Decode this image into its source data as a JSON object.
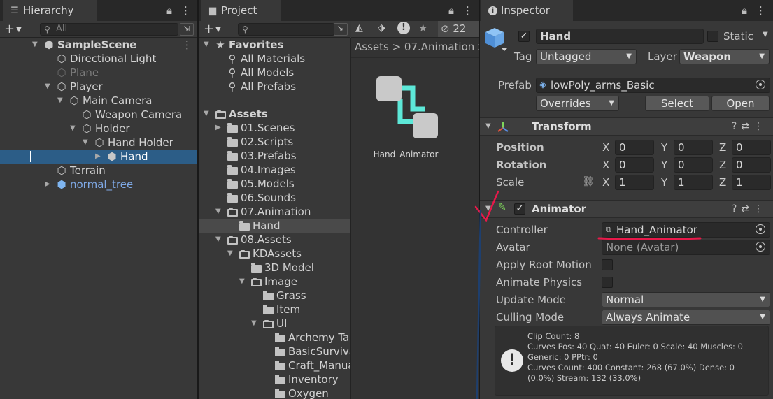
{
  "hierarchy": {
    "tab_label": "Hierarchy",
    "search_placeholder": "All",
    "items": [
      {
        "label": "SampleScene",
        "depth": 0,
        "arrow": "expanded",
        "icon": "unity-scene-icon",
        "style": "scene"
      },
      {
        "label": "Directional Light",
        "depth": 1,
        "arrow": "none",
        "icon": "cube-outline-icon",
        "style": "normal"
      },
      {
        "label": "Plane",
        "depth": 1,
        "arrow": "none",
        "icon": "cube-outline-icon",
        "style": "dim"
      },
      {
        "label": "Player",
        "depth": 1,
        "arrow": "expanded",
        "icon": "cube-outline-icon",
        "style": "normal"
      },
      {
        "label": "Main Camera",
        "depth": 2,
        "arrow": "expanded",
        "icon": "cube-outline-icon",
        "style": "normal"
      },
      {
        "label": "Weapon Camera",
        "depth": 3,
        "arrow": "none",
        "icon": "cube-outline-icon",
        "style": "normal"
      },
      {
        "label": "Holder",
        "depth": 3,
        "arrow": "expanded",
        "icon": "cube-outline-icon",
        "style": "normal"
      },
      {
        "label": "Hand Holder",
        "depth": 4,
        "arrow": "expanded",
        "icon": "cube-outline-icon",
        "style": "normal"
      },
      {
        "label": "Hand",
        "depth": 5,
        "arrow": "collapsed",
        "icon": "prefab-cube-icon",
        "style": "selected"
      },
      {
        "label": "Terrain",
        "depth": 1,
        "arrow": "none",
        "icon": "cube-outline-icon",
        "style": "normal"
      },
      {
        "label": "normal_tree",
        "depth": 1,
        "arrow": "collapsed",
        "icon": "prefab-cube-icon",
        "style": "prefab"
      }
    ]
  },
  "project": {
    "tab_label": "Project",
    "hidden_count": "22",
    "breadcrumb": "Assets  >  07.Animation  >",
    "tree": [
      {
        "label": "Favorites",
        "depth": 0,
        "arrow": "expanded",
        "icon": "star-icon",
        "style": "bold"
      },
      {
        "label": "All Materials",
        "depth": 1,
        "arrow": "none",
        "icon": "search-icon",
        "style": "normal"
      },
      {
        "label": "All Models",
        "depth": 1,
        "arrow": "none",
        "icon": "search-icon",
        "style": "normal"
      },
      {
        "label": "All Prefabs",
        "depth": 1,
        "arrow": "none",
        "icon": "search-icon",
        "style": "normal"
      },
      {
        "label": "Assets",
        "depth": 0,
        "arrow": "expanded",
        "icon": "folder-open-icon",
        "style": "bold"
      },
      {
        "label": "01.Scenes",
        "depth": 1,
        "arrow": "collapsed",
        "icon": "folder-icon",
        "style": "normal"
      },
      {
        "label": "02.Scripts",
        "depth": 1,
        "arrow": "none",
        "icon": "folder-icon",
        "style": "normal"
      },
      {
        "label": "03.Prefabs",
        "depth": 1,
        "arrow": "none",
        "icon": "folder-icon",
        "style": "normal"
      },
      {
        "label": "04.Images",
        "depth": 1,
        "arrow": "none",
        "icon": "folder-icon",
        "style": "normal"
      },
      {
        "label": "05.Models",
        "depth": 1,
        "arrow": "none",
        "icon": "folder-icon",
        "style": "normal"
      },
      {
        "label": "06.Sounds",
        "depth": 1,
        "arrow": "none",
        "icon": "folder-icon",
        "style": "normal"
      },
      {
        "label": "07.Animation",
        "depth": 1,
        "arrow": "expanded",
        "icon": "folder-open-icon",
        "style": "normal"
      },
      {
        "label": "Hand",
        "depth": 2,
        "arrow": "none",
        "icon": "folder-icon",
        "style": "selected"
      },
      {
        "label": "08.Assets",
        "depth": 1,
        "arrow": "expanded",
        "icon": "folder-open-icon",
        "style": "normal"
      },
      {
        "label": "KDAssets",
        "depth": 2,
        "arrow": "expanded",
        "icon": "folder-open-icon",
        "style": "normal"
      },
      {
        "label": "3D Model",
        "depth": 3,
        "arrow": "none",
        "icon": "folder-icon",
        "style": "normal"
      },
      {
        "label": "Image",
        "depth": 3,
        "arrow": "expanded",
        "icon": "folder-open-icon",
        "style": "normal"
      },
      {
        "label": "Grass",
        "depth": 4,
        "arrow": "none",
        "icon": "folder-icon",
        "style": "normal"
      },
      {
        "label": "Item",
        "depth": 4,
        "arrow": "none",
        "icon": "folder-icon",
        "style": "normal"
      },
      {
        "label": "UI",
        "depth": 4,
        "arrow": "expanded",
        "icon": "folder-open-icon",
        "style": "normal"
      },
      {
        "label": "Archemy Tal",
        "depth": 5,
        "arrow": "none",
        "icon": "folder-icon",
        "style": "normal"
      },
      {
        "label": "BasicSurviva",
        "depth": 5,
        "arrow": "none",
        "icon": "folder-icon",
        "style": "normal"
      },
      {
        "label": "Craft_Manua",
        "depth": 5,
        "arrow": "none",
        "icon": "folder-icon",
        "style": "normal"
      },
      {
        "label": "Inventory",
        "depth": 5,
        "arrow": "none",
        "icon": "folder-icon",
        "style": "normal"
      },
      {
        "label": "Oxygen",
        "depth": 5,
        "arrow": "none",
        "icon": "folder-icon",
        "style": "normal"
      }
    ],
    "asset_label": "Hand_Animator"
  },
  "inspector": {
    "tab_label": "Inspector",
    "object_name": "Hand",
    "static_label": "Static",
    "tag_label": "Tag",
    "tag_value": "Untagged",
    "layer_label": "Layer",
    "layer_value": "Weapon",
    "prefab_label": "Prefab",
    "prefab_value": "lowPoly_arms_Basic",
    "overrides_label": "Overrides",
    "select_label": "Select",
    "open_label": "Open",
    "transform": {
      "title": "Transform",
      "rows": [
        {
          "label": "Position",
          "x": "0",
          "y": "0",
          "z": "0",
          "bold": true
        },
        {
          "label": "Rotation",
          "x": "0",
          "y": "0",
          "z": "0",
          "bold": true
        },
        {
          "label": "Scale",
          "x": "1",
          "y": "1",
          "z": "1",
          "bold": false
        }
      ]
    },
    "animator": {
      "title": "Animator",
      "controller_label": "Controller",
      "controller_value": "Hand_Animator",
      "avatar_label": "Avatar",
      "avatar_value": "None (Avatar)",
      "apply_root_motion_label": "Apply Root Motion",
      "animate_physics_label": "Animate Physics",
      "update_mode_label": "Update Mode",
      "update_mode_value": "Normal",
      "culling_mode_label": "Culling Mode",
      "culling_mode_value": "Always Animate",
      "info": "Clip Count: 8\nCurves Pos: 40 Quat: 40 Euler: 0 Scale: 40 Muscles: 0\nGeneric: 0 PPtr: 0\nCurves Count: 400 Constant: 268 (67.0%) Dense: 0\n(0.0%) Stream: 132 (33.0%)"
    }
  },
  "colors": {
    "panel": "#383838",
    "tabbar": "#282828",
    "selection": "#2c5d87",
    "prefab_text": "#7fa9e6",
    "annotation": "#e8194a",
    "animator_graph": "#5de8d8"
  }
}
